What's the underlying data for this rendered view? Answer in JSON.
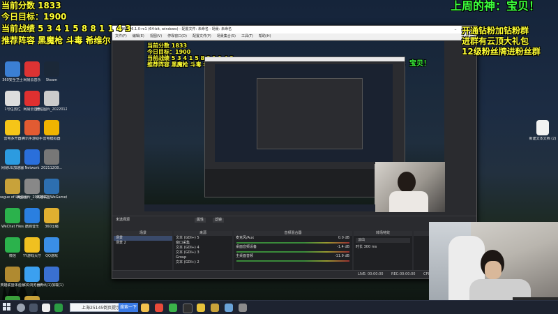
{
  "overlay": {
    "score_line": "当前分数 1833",
    "goal_line": "今日目标：1900",
    "record_line": "当前战绩 5 3 4 1 5 8 8 1 1 4 3",
    "recommend_line": "推荐阵容 黑魔枪 斗毒 希维尔",
    "god_line": "上周的神：宝贝！",
    "promo_lines": [
      "开通钻粉加钻粉群",
      "进群有云顶大礼包",
      "12级粉丝牌进粉丝群"
    ]
  },
  "obs": {
    "window_title": "OBS 26.1.0-rc1 (64-bit, windows) - 配置文件: 未命名 - 场景: 未命名",
    "menu": [
      "文件(F)",
      "编辑(E)",
      "视图(V)",
      "停靠窗口(D)",
      "配置文件(P)",
      "场景集合(S)",
      "工具(T)",
      "帮助(H)"
    ],
    "no_source_label": "未选择源",
    "properties_label": "属性",
    "filters_label": "滤镜",
    "docks": {
      "scenes": {
        "title": "场景",
        "items": [
          "场景",
          "场景 2"
        ]
      },
      "sources": {
        "title": "来源",
        "items": [
          "文本 (GDI+) 5",
          "窗口采集",
          "文本 (GDI+) 4",
          "文本 (GDI+) 3",
          "Group",
          "文本 (GDI+) 2"
        ]
      },
      "mixer": {
        "title": "音频混合器",
        "tracks": [
          {
            "name": "麦克风/Aux",
            "db": "0.0 dB"
          },
          {
            "name": "桌面音频设备",
            "db": "-1.4 dB"
          },
          {
            "name": "主桌面音频",
            "db": "-11.9 dB"
          }
        ]
      },
      "transitions": {
        "title": "转场特效",
        "type": "淡出",
        "duration_label": "时长",
        "duration": "300 ms"
      },
      "controls": {
        "title": "控件"
      }
    },
    "status": {
      "live_label": "LIVE:",
      "live_time": "00:00:00",
      "rec_label": "REC:",
      "rec_time": "00:00:00",
      "cpu_label": "CPU:"
    }
  },
  "desktop": {
    "icons": [
      {
        "label": "360安全卫士",
        "color": "#3b7fd4"
      },
      {
        "label": "网易云音乐",
        "color": "#d33"
      },
      {
        "label": "Steam",
        "color": "#1b2838"
      },
      {
        "label": "1号任务栏",
        "color": "#ddd"
      },
      {
        "label": "网易云音乐",
        "color": "#e03030"
      },
      {
        "label": "微信图片_20220121...",
        "color": "#ccc"
      },
      {
        "label": "雷电多开器",
        "color": "#f5c518"
      },
      {
        "label": "腾讯手游助手",
        "color": "#e25b32"
      },
      {
        "label": "雷电模拟器",
        "color": "#f0b400"
      },
      {
        "label": "网易UU加速器",
        "color": "#2c9be0"
      },
      {
        "label": "Network",
        "color": "#2a6fdb"
      },
      {
        "label": "20211208...",
        "color": "#777"
      },
      {
        "label": "League of Legends",
        "color": "#c8a23a"
      },
      {
        "label": "微信图片_20220121...",
        "color": "#888"
      },
      {
        "label": "英雄联盟WeGame版",
        "color": "#2d6fb0"
      },
      {
        "label": "WeChat Files",
        "color": "#2bb24c"
      },
      {
        "label": "酷狗音乐",
        "color": "#2a7fe0"
      },
      {
        "label": "360压缩",
        "color": "#e0b030"
      },
      {
        "label": "微信",
        "color": "#2bb24c"
      },
      {
        "label": "YY游戏大厅",
        "color": "#f0c020"
      },
      {
        "label": "QQ游戏",
        "color": "#3a8ee6"
      },
      {
        "label": "英雄联盟体验服",
        "color": "#b08a30"
      },
      {
        "label": "QQ浏览器",
        "color": "#3ba0f0"
      },
      {
        "label": "腾讯(1)加载(1)",
        "color": "#3a70d0"
      },
      {
        "label": "360软件管家",
        "color": "#3b9f3b"
      },
      {
        "label": "Client",
        "color": "#c8a23a"
      }
    ],
    "right_icon_label": "新建文本文档 (2)"
  },
  "taskbar": {
    "search_text": "上海25145倒页提示",
    "search_btn": "搜索一下"
  }
}
